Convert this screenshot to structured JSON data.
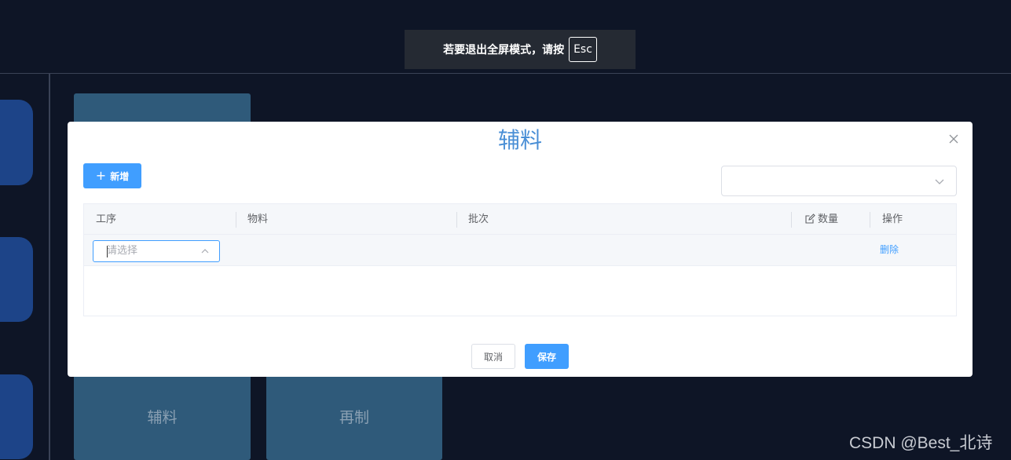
{
  "fullscreen_hint": {
    "text": "若要退出全屏模式，请按",
    "key": "Esc"
  },
  "background": {
    "tiles": [
      {
        "label": ""
      },
      {
        "label": "辅料"
      },
      {
        "label": "再制"
      }
    ]
  },
  "dialog": {
    "title": "辅料",
    "add_button_label": "新增",
    "table": {
      "columns": [
        {
          "label": "工序"
        },
        {
          "label": "物料"
        },
        {
          "label": "批次"
        },
        {
          "label": "数量"
        },
        {
          "label": "操作"
        }
      ],
      "rows": [
        {
          "process_placeholder": "请选择",
          "material": "",
          "batch": "",
          "quantity": "",
          "action_label": "删除"
        }
      ]
    },
    "cancel_label": "取消",
    "save_label": "保存"
  },
  "watermark": "CSDN @Best_北诗",
  "colors": {
    "primary": "#409eff",
    "title": "#4a8fd6",
    "background": "#0e1526",
    "tile": "#2f5a7a",
    "side_card": "#1d4488"
  }
}
